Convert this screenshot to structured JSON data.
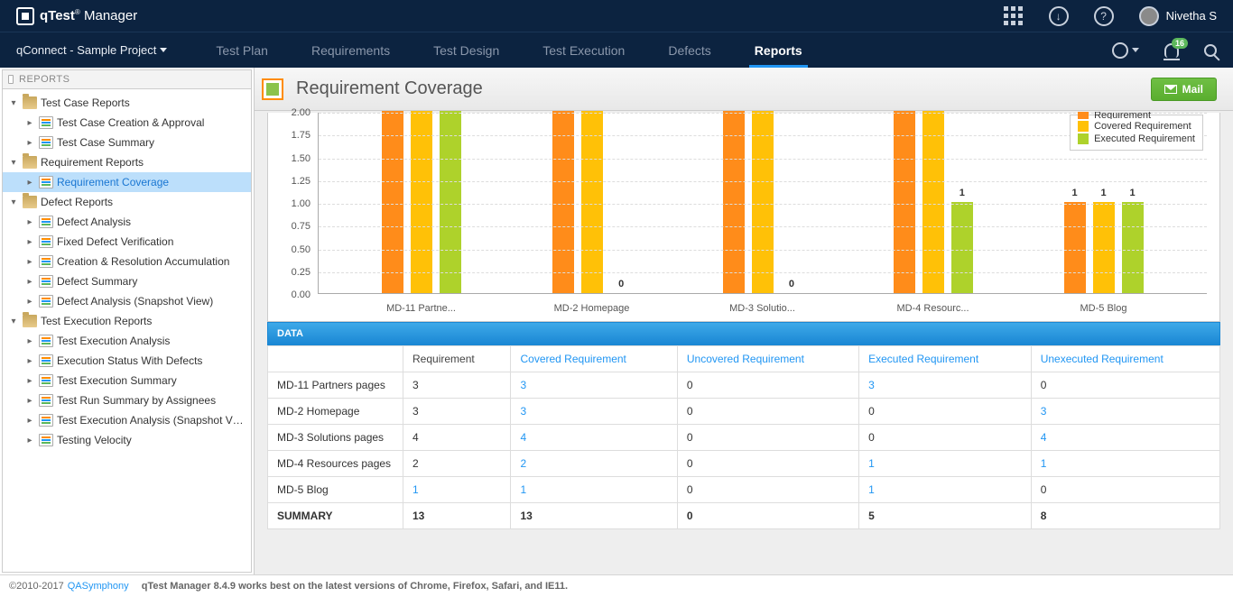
{
  "app": {
    "brand_strong": "qTest",
    "brand_light": "Manager",
    "trademark": "®"
  },
  "user": {
    "name": "Nivetha S"
  },
  "project": {
    "name": "qConnect - Sample Project"
  },
  "nav": {
    "tabs": [
      {
        "label": "Test Plan"
      },
      {
        "label": "Requirements"
      },
      {
        "label": "Test Design"
      },
      {
        "label": "Test Execution"
      },
      {
        "label": "Defects"
      },
      {
        "label": "Reports"
      }
    ],
    "badge": "16"
  },
  "sidebar": {
    "title": "REPORTS",
    "groups": [
      {
        "label": "Test Case Reports",
        "items": [
          {
            "label": "Test Case Creation & Approval"
          },
          {
            "label": "Test Case Summary"
          }
        ]
      },
      {
        "label": "Requirement Reports",
        "items": [
          {
            "label": "Requirement Coverage"
          }
        ]
      },
      {
        "label": "Defect Reports",
        "items": [
          {
            "label": "Defect Analysis"
          },
          {
            "label": "Fixed Defect Verification"
          },
          {
            "label": "Creation & Resolution Accumulation"
          },
          {
            "label": "Defect Summary"
          },
          {
            "label": "Defect Analysis (Snapshot View)"
          }
        ]
      },
      {
        "label": "Test Execution Reports",
        "items": [
          {
            "label": "Test Execution Analysis"
          },
          {
            "label": "Execution Status With Defects"
          },
          {
            "label": "Test Execution Summary"
          },
          {
            "label": "Test Run Summary by Assignees"
          },
          {
            "label": "Test Execution Analysis (Snapshot View)"
          },
          {
            "label": "Testing Velocity"
          }
        ]
      }
    ]
  },
  "page": {
    "title": "Requirement Coverage",
    "mail_label": "Mail"
  },
  "chart_data": {
    "type": "bar",
    "legend_cut": "Requirement",
    "ylim": [
      0,
      2
    ],
    "yticks": [
      "0.00",
      "0.25",
      "0.50",
      "0.75",
      "1.00",
      "1.25",
      "1.50",
      "1.75",
      "2.00"
    ],
    "categories_full": [
      "MD-11 Partners pages",
      "MD-2 Homepage",
      "MD-3 Solutions pages",
      "MD-4 Resources pages",
      "MD-5 Blog"
    ],
    "categories_display": [
      "MD-11 Partne...",
      "MD-2 Homepage",
      "MD-3 Solutio...",
      "MD-4 Resourc...",
      "MD-5 Blog"
    ],
    "series": [
      {
        "name": "Requirement",
        "color": "#ff8c1a",
        "values": [
          3,
          3,
          4,
          2,
          1
        ],
        "display": [
          2,
          2,
          2,
          2,
          1
        ],
        "labels": [
          null,
          null,
          null,
          null,
          "1"
        ]
      },
      {
        "name": "Covered Requirement",
        "color": "#ffc107",
        "values": [
          3,
          3,
          4,
          2,
          1
        ],
        "display": [
          2,
          2,
          2,
          2,
          1
        ],
        "labels": [
          null,
          null,
          null,
          null,
          "1"
        ]
      },
      {
        "name": "Executed Requirement",
        "color": "#aed22b",
        "values": [
          3,
          0,
          0,
          1,
          1
        ],
        "display": [
          2,
          0,
          0,
          1,
          1
        ],
        "labels": [
          null,
          "0",
          "0",
          "1",
          "1"
        ]
      }
    ]
  },
  "table": {
    "header": "DATA",
    "columns": [
      "Requirement",
      "Covered Requirement",
      "Uncovered Requirement",
      "Executed Requirement",
      "Unexecuted Requirement"
    ],
    "rows": [
      {
        "name": "MD-11 Partners pages",
        "req": "3",
        "cov": "3",
        "covlink": true,
        "unc": "0",
        "exe": "3",
        "exelink": true,
        "une": "0"
      },
      {
        "name": "MD-2 Homepage",
        "req": "3",
        "cov": "3",
        "covlink": true,
        "unc": "0",
        "exe": "0",
        "une": "3",
        "unelink": true
      },
      {
        "name": "MD-3 Solutions pages",
        "req": "4",
        "cov": "4",
        "covlink": true,
        "unc": "0",
        "exe": "0",
        "une": "4",
        "unelink": true
      },
      {
        "name": "MD-4 Resources pages",
        "req": "2",
        "cov": "2",
        "covlink": true,
        "unc": "0",
        "exe": "1",
        "exelink": true,
        "une": "1",
        "unelink": true
      },
      {
        "name": "MD-5 Blog",
        "req": "1",
        "reqlink": true,
        "cov": "1",
        "covlink": true,
        "unc": "0",
        "exe": "1",
        "exelink": true,
        "une": "0"
      }
    ],
    "summary": {
      "label": "SUMMARY",
      "req": "13",
      "cov": "13",
      "unc": "0",
      "exe": "5",
      "une": "8"
    }
  },
  "footer": {
    "copyright": "©2010-2017",
    "link": "QASymphony",
    "text": "qTest Manager 8.4.9 works best on the latest versions of Chrome, Firefox, Safari, and IE11."
  }
}
